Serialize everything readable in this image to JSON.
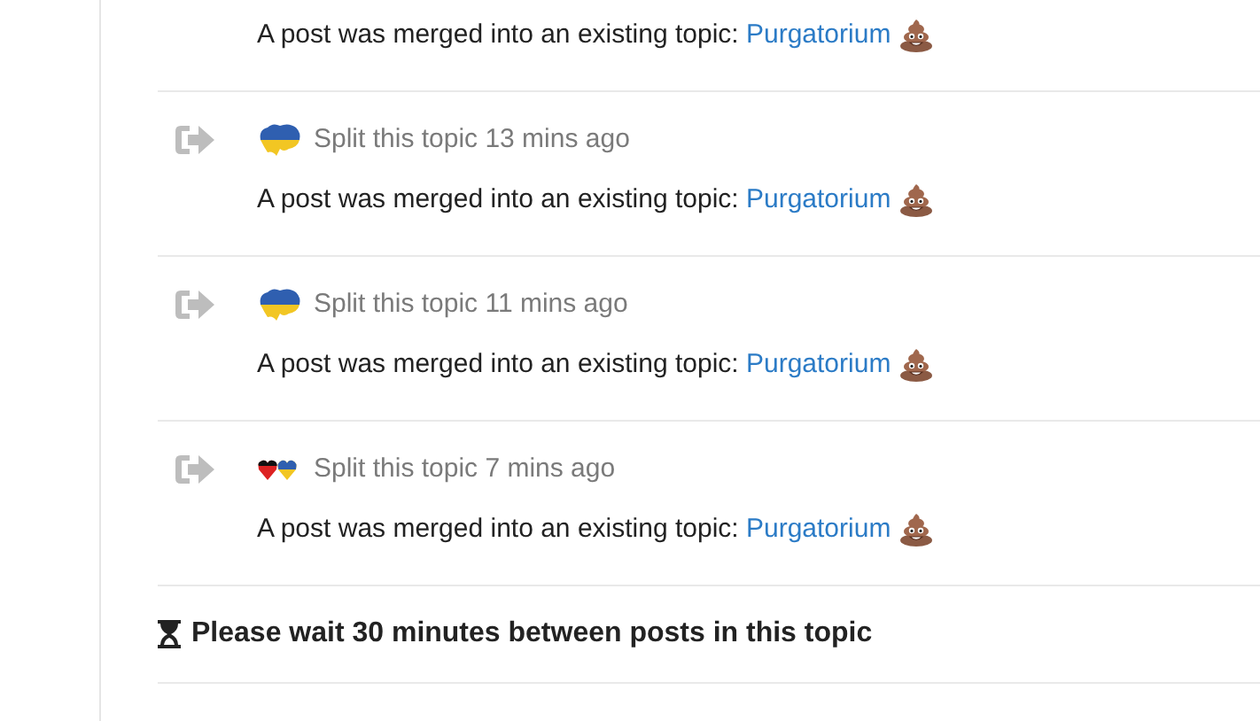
{
  "events": [
    {
      "body": "A post was merged into an existing topic: ",
      "link": "Purgatorium"
    },
    {
      "avatar": {
        "kind": "map"
      },
      "action": "Split this topic 13 mins ago",
      "body": "A post was merged into an existing topic: ",
      "link": "Purgatorium"
    },
    {
      "avatar": {
        "kind": "map"
      },
      "action": "Split this topic 11 mins ago",
      "body": "A post was merged into an existing topic: ",
      "link": "Purgatorium"
    },
    {
      "avatar": {
        "kind": "hearts"
      },
      "action": "Split this topic 7 mins ago",
      "body": "A post was merged into an existing topic: ",
      "link": "Purgatorium"
    }
  ],
  "notice": "Please wait 30 minutes between posts in this topic"
}
